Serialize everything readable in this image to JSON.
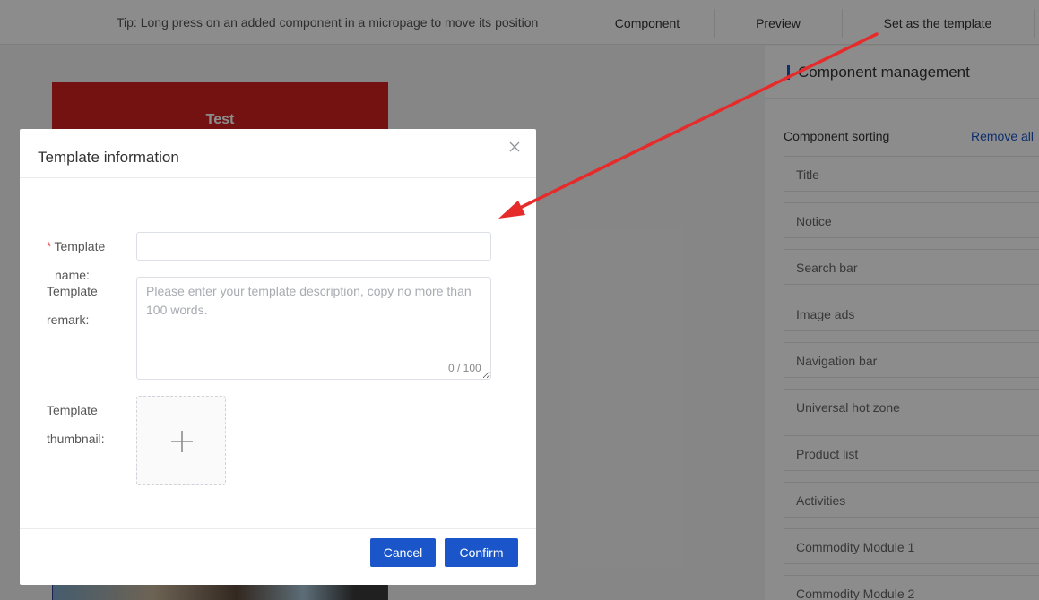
{
  "header": {
    "tip": "Tip: Long press on an added component in a micropage to move its position",
    "nav": {
      "component": "Component",
      "preview": "Preview",
      "set_template": "Set as the template"
    }
  },
  "canvas": {
    "page_title": "Test"
  },
  "side_panel": {
    "title": "Component management",
    "sorting_label": "Component sorting",
    "remove_all": "Remove all",
    "components": [
      "Title",
      "Notice",
      "Search bar",
      "Image ads",
      "Navigation bar",
      "Universal hot zone",
      "Product list",
      "Activities",
      "Commodity Module 1",
      "Commodity Module 2"
    ]
  },
  "dialog": {
    "title": "Template information",
    "name_label_line1": "Template",
    "name_label_line2": "name:",
    "name_required_mark": "*",
    "name_value": "",
    "remark_label_line1": "Template",
    "remark_label_line2": "remark:",
    "remark_placeholder": "Please enter your template description, copy no more than 100 words.",
    "remark_counter": "0 / 100",
    "thumbnail_label_line1": "Template",
    "thumbnail_label_line2": "thumbnail:",
    "cancel_label": "Cancel",
    "confirm_label": "Confirm"
  },
  "colors": {
    "accent": "#1a55c9",
    "header_red": "#d42121",
    "annotation_arrow": "#e62b2b",
    "required_mark": "#e34a4a"
  }
}
